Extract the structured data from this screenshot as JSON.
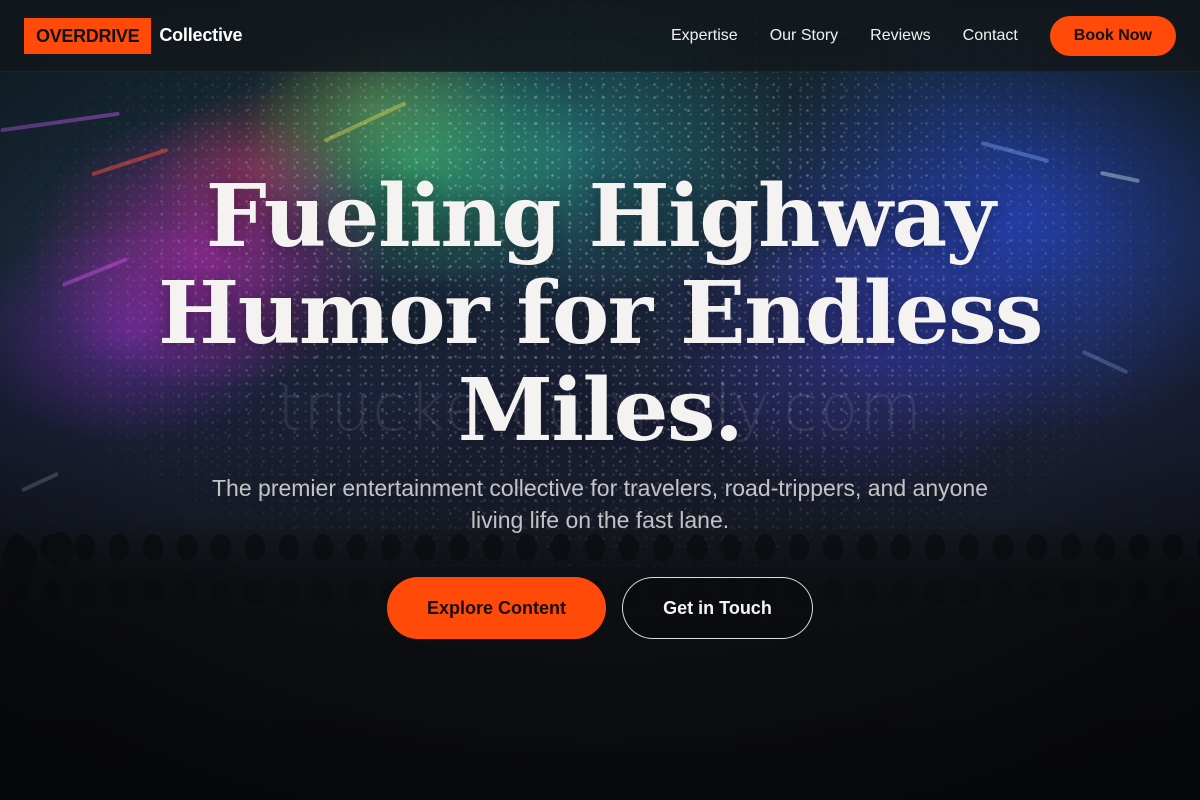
{
  "brand": {
    "badge": "OVERDRIVE",
    "name": "Collective"
  },
  "nav": {
    "items": [
      {
        "label": "Expertise"
      },
      {
        "label": "Our Story"
      },
      {
        "label": "Reviews"
      },
      {
        "label": "Contact"
      }
    ],
    "cta_label": "Book Now"
  },
  "hero": {
    "title_line1": "Fueling Highway",
    "title_line2": "Humor for Endless",
    "title_line3": "Miles.",
    "subtitle": "The premier entertainment collective for travelers, road-trippers, and anyone living life on the fast lane.",
    "primary_button": "Explore Content",
    "secondary_button": "Get in Touch",
    "watermark": "truckercomedy.com",
    "background_icon": "concert-crowd-image"
  },
  "colors": {
    "accent": "#ff4a0a",
    "navbar_bg": "#12181c",
    "title_text": "#f4f3f1"
  }
}
